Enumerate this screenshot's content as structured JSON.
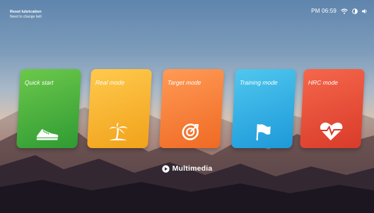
{
  "status_bar": {
    "notice_title": "Reset lubrication",
    "notice_subtitle": "Need to change belt",
    "clock": "PM 06:59",
    "icons": [
      "wifi-icon",
      "brightness-icon",
      "volume-icon"
    ]
  },
  "cards": [
    {
      "label": "Quick start",
      "icon": "running-shoe-icon",
      "color": "#3fae38"
    },
    {
      "label": "Real mode",
      "icon": "palm-tree-icon",
      "color": "#f6b733"
    },
    {
      "label": "Target mode",
      "icon": "target-icon",
      "color": "#f5813b"
    },
    {
      "label": "Training mode",
      "icon": "flag-icon",
      "color": "#34b2e6"
    },
    {
      "label": "HRC mode",
      "icon": "heart-rate-icon",
      "color": "#e8503a"
    }
  ],
  "bottom": {
    "multimedia_label": "Multimedia",
    "icon": "play-icon"
  }
}
